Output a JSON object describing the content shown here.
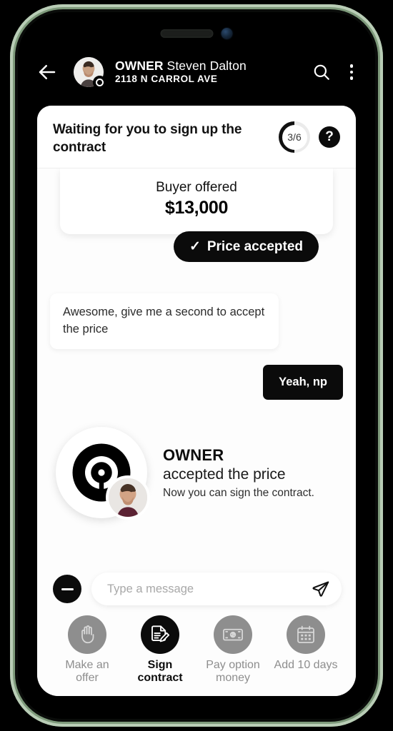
{
  "device": {
    "frame_color": "#9ab398",
    "island": {
      "speaker": "speaker-grille",
      "camera": "front-camera"
    }
  },
  "header": {
    "back_icon": "back-arrow-icon",
    "avatar": "user-avatar",
    "avatar_badge": "owner-ring-badge",
    "role": "OWNER",
    "name": "Steven Dalton",
    "address": "2118 N CARROL AVE",
    "search_icon": "search-icon",
    "menu_icon": "more-vertical-icon"
  },
  "deal_status": {
    "title": "Waiting for you to sign up the contract",
    "progress_label": "3/6",
    "progress_current": 3,
    "progress_total": 6,
    "help_label": "?"
  },
  "offer_card": {
    "title": "Buyer offered",
    "amount": "$13,000",
    "status_check": "✓",
    "status_label": "Price accepted"
  },
  "messages": [
    {
      "side": "left",
      "text": "Awesome, give me a second to accept the price"
    },
    {
      "side": "right",
      "text": "Yeah, np"
    }
  ],
  "event": {
    "logo_icon": "owner-wheel-logo",
    "avatar": "owner-avatar",
    "title": "OWNER",
    "subtitle": "accepted the price",
    "note": "Now you can sign the contract."
  },
  "composer": {
    "attach_icon": "minus-circle-icon",
    "placeholder": "Type a message",
    "value": "",
    "send_icon": "send-paper-plane-icon"
  },
  "action_bar": {
    "items": [
      {
        "icon": "hand-stop-icon",
        "label": "Make an offer",
        "active": false
      },
      {
        "icon": "sign-document-icon",
        "label": "Sign contract",
        "active": true
      },
      {
        "icon": "banknote-icon",
        "label": "Pay option money",
        "active": false
      },
      {
        "icon": "calendar-icon",
        "label": "Add 10 days",
        "active": false
      }
    ]
  },
  "colors": {
    "accent": "#0b0b0b",
    "panel": "#fdfdfd",
    "muted": "#8e8e8e",
    "frame": "#9ab398"
  }
}
